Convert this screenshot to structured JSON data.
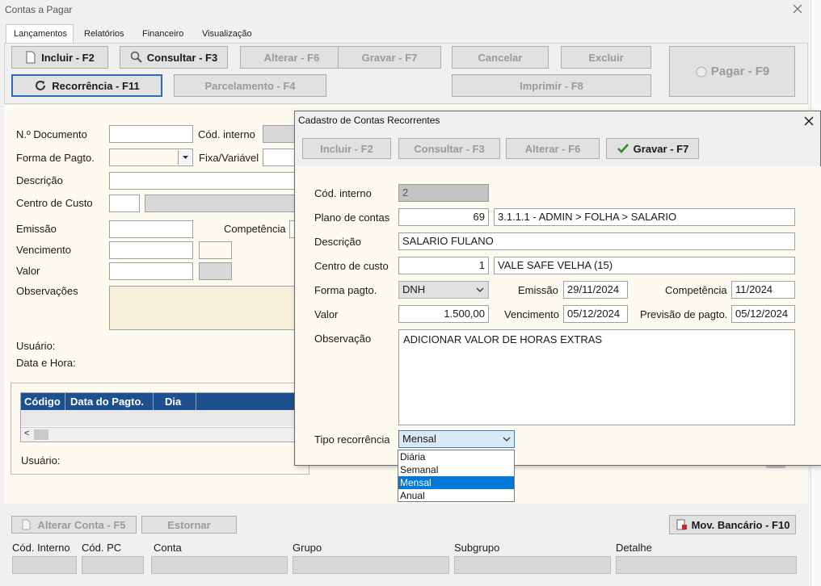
{
  "window": {
    "title": "Contas a Pagar"
  },
  "tabs": [
    "Lançamentos",
    "Relatórios",
    "Financeiro",
    "Visualização"
  ],
  "toolbar": {
    "incluir": "Incluir - F2",
    "consultar": "Consultar - F3",
    "alterar": "Alterar - F6",
    "gravar": "Gravar - F7",
    "cancelar": "Cancelar",
    "excluir": "Excluir",
    "pagar": "Pagar - F9",
    "recorrencia": "Recorrência - F11",
    "parcelamento": "Parcelamento - F4",
    "imprimir": "Imprimir - F8"
  },
  "form": {
    "documento_label": "N.º Documento",
    "cod_interno_label": "Cód. interno",
    "forma_label": "Forma de Pagto.",
    "fixa_label": "Fixa/Variável",
    "descricao_label": "Descrição",
    "centro_label": "Centro de Custo",
    "emissao_label": "Emissão",
    "competencia_label": "Competência",
    "vencimento_label": "Vencimento",
    "valor_label": "Valor",
    "observacoes_label": "Observações",
    "usuario_label": "Usuário:",
    "datahora_label": "Data e Hora:"
  },
  "grid": {
    "columns": [
      "Código",
      "Data do Pagto.",
      "Dia"
    ],
    "scroll_left": "<",
    "usuario_label": "Usuário:"
  },
  "bottom": {
    "alterar_conta": "Alterar Conta - F5",
    "estornar": "Estornar",
    "mov_bancario": "Mov. Bancário - F10",
    "cod_interno": "Cód. Interno",
    "cod_pc": "Cód. PC",
    "conta": "Conta",
    "grupo": "Grupo",
    "subgrupo": "Subgrupo",
    "detalhe": "Detalhe"
  },
  "dialog": {
    "title": "Cadastro de Contas Recorrentes",
    "incluir": "Incluir - F2",
    "consultar": "Consultar - F3",
    "alterar": "Alterar - F6",
    "gravar": "Gravar - F7",
    "cod_interno_label": "Cód. interno",
    "cod_interno": "2",
    "plano_label": "Plano de contas",
    "plano_code": "69",
    "plano_desc": "3.1.1.1 - ADMIN > FOLHA > SALARIO",
    "descricao_label": "Descrição",
    "descricao": "SALARIO FULANO",
    "centro_label": "Centro de custo",
    "centro_code": "1",
    "centro_desc": "VALE SAFE VELHA (15)",
    "forma_label": "Forma pagto.",
    "forma": "DNH",
    "emissao_label": "Emissão",
    "emissao": "29/11/2024",
    "competencia_label": "Competência",
    "competencia": "11/2024",
    "valor_label": "Valor",
    "valor": "1.500,00",
    "vencimento_label": "Vencimento",
    "vencimento": "05/12/2024",
    "previsao_label": "Previsão de pagto.",
    "previsao": "05/12/2024",
    "observacao_label": "Observação",
    "observacao": "ADICIONAR VALOR DE HORAS EXTRAS",
    "tipo_label": "Tipo recorrência",
    "tipo": "Mensal",
    "tipo_options": [
      "Diária",
      "Semanal",
      "Mensal",
      "Anual"
    ]
  },
  "icons": {
    "close": "close-icon",
    "refresh": "refresh-icon",
    "search": "search-icon",
    "check": "check-icon"
  }
}
